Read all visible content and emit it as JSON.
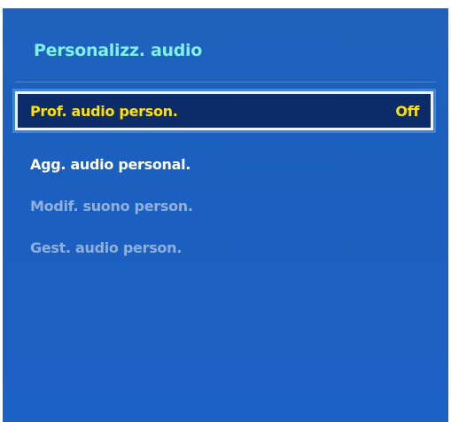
{
  "menu": {
    "title": "Personalizz. audio",
    "items": [
      {
        "label": "Prof. audio person.",
        "value": "Off",
        "state": "selected"
      },
      {
        "label": "Agg. audio personal.",
        "value": "",
        "state": "enabled"
      },
      {
        "label": "Modif. suono person.",
        "value": "",
        "state": "disabled"
      },
      {
        "label": "Gest. audio person.",
        "value": "",
        "state": "disabled"
      }
    ]
  },
  "colors": {
    "panel_background": "#1c60c0",
    "title_text": "#7ff0e8",
    "selected_text": "#ffe000",
    "selected_background": "#0b2c69",
    "enabled_text": "#ffffff",
    "disabled_text": "#8fb0dd"
  }
}
